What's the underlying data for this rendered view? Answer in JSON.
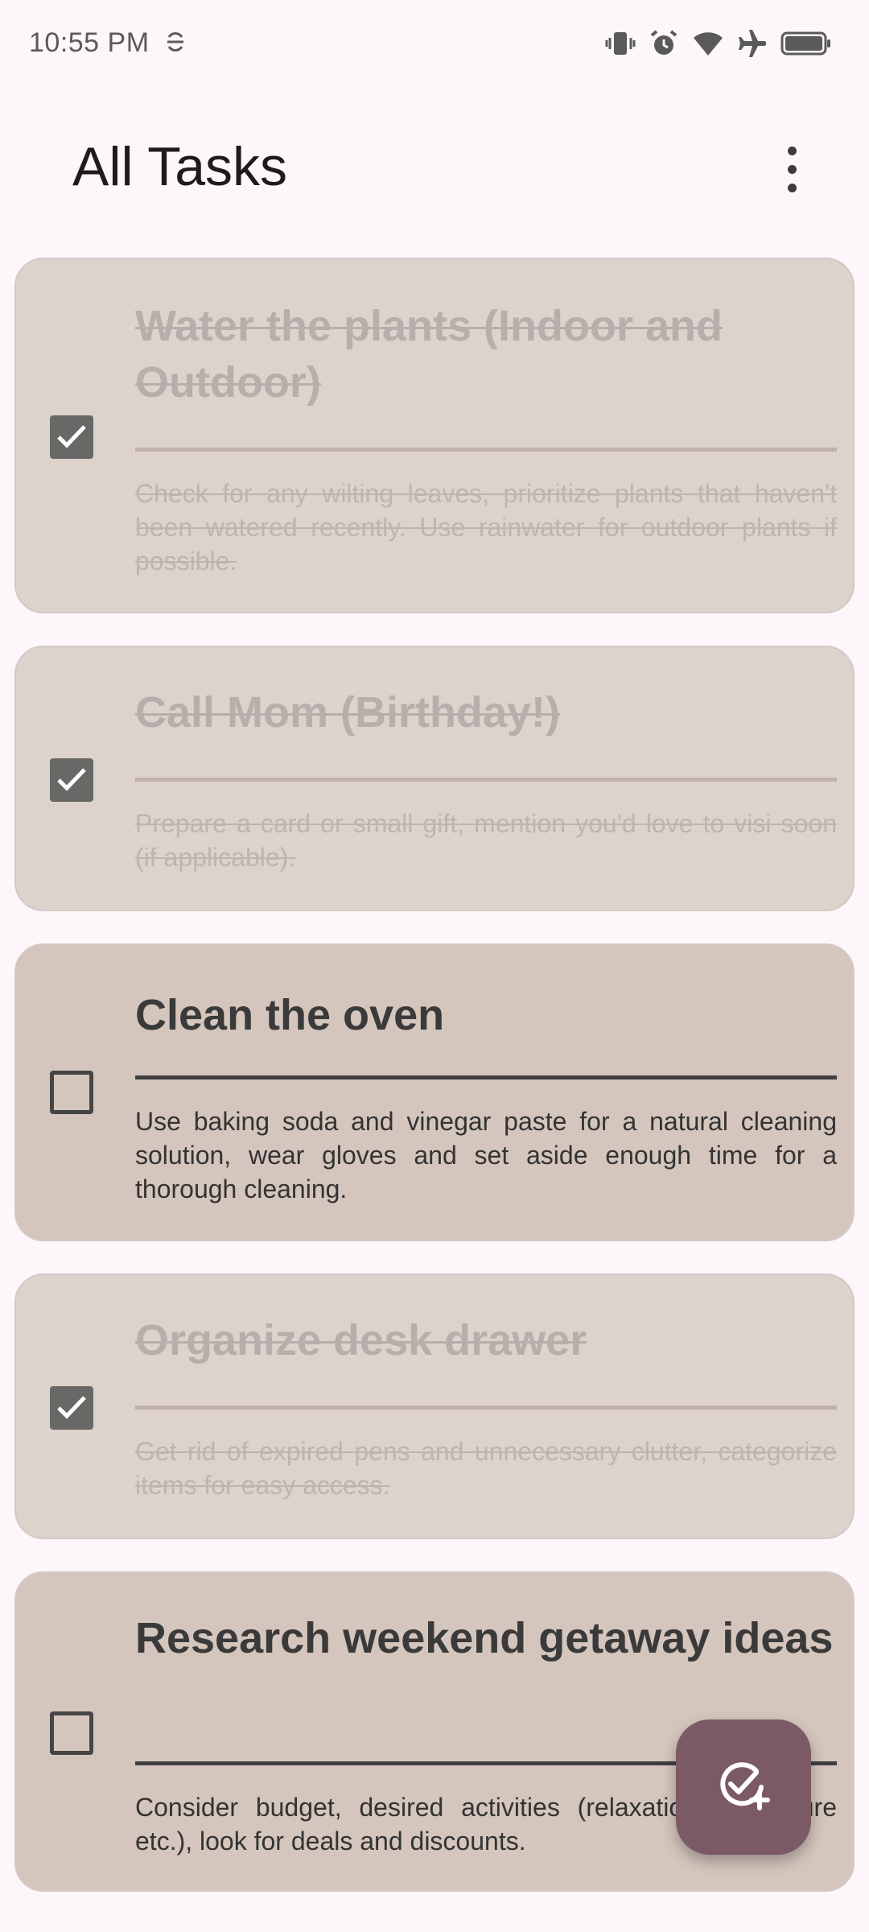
{
  "status_bar": {
    "time": "10:55 PM",
    "icons": [
      "app-notification-icon",
      "vibrate-icon",
      "alarm-icon",
      "wifi-icon",
      "airplane-mode-icon",
      "battery-icon"
    ]
  },
  "app_bar": {
    "title": "All Tasks",
    "menu_icon": "more-vert-icon"
  },
  "tasks": [
    {
      "title": "Water the plants (Indoor and Outdoor)",
      "description": "Check for any wilting leaves, prioritize plants that haven't been watered recently. Use rainwater for outdoor plants if possible.",
      "completed": true
    },
    {
      "title": "Call Mom (Birthday!)",
      "description": "Prepare a card or small gift, mention you'd love to visi soon (if applicable).",
      "completed": true
    },
    {
      "title": "Clean the oven",
      "description": "Use baking soda and vinegar paste for a natural cleaning solution, wear gloves and set aside enough time for a thorough cleaning.",
      "completed": false
    },
    {
      "title": "Organize desk drawer",
      "description": "Get rid of expired pens and unnecessary clutter, categorize items for easy access.",
      "completed": true
    },
    {
      "title": "Research weekend getaway ideas",
      "description": "Consider budget, desired activities (relaxation, adventure etc.), look for deals and discounts.",
      "completed": false
    }
  ],
  "fab": {
    "icon": "add-task-icon"
  },
  "colors": {
    "background": "#fdf6fb",
    "card_completed": "#ded2cc",
    "card_pending": "#d5c6bd",
    "fab": "#7b5a66"
  }
}
